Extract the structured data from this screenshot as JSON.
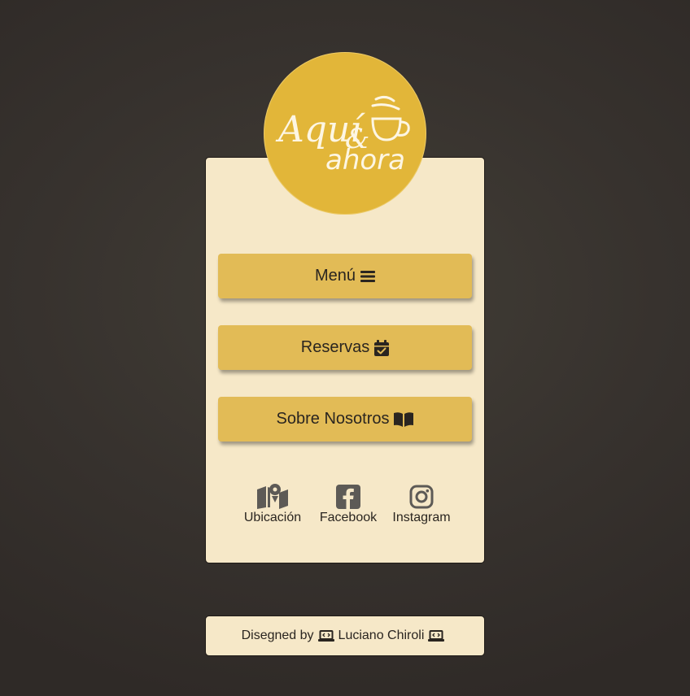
{
  "logo": {
    "line1": "Aquí",
    "amp": "&",
    "line2": "ahora",
    "icon": "coffee-cup-icon"
  },
  "buttons": {
    "menu_label": "Menú",
    "menu_icon": "bars-icon",
    "reservas_label": "Reservas",
    "reservas_icon": "calendar-check-icon",
    "about_label": "Sobre Nosotros",
    "about_icon": "book-open-icon"
  },
  "social": {
    "ubicacion_label": "Ubicación",
    "ubicacion_icon": "map-location-icon",
    "facebook_label": "Facebook",
    "facebook_icon": "facebook-icon",
    "instagram_label": "Instagram",
    "instagram_icon": "instagram-icon"
  },
  "footer": {
    "prefix": "Disegned by",
    "author": "Luciano Chiroli",
    "icon": "laptop-code-icon"
  },
  "colors": {
    "background": "#37322e",
    "card": "#f6e8c8",
    "button": "#e2bb56",
    "logo_circle": "#e2b639",
    "text": "#2a2520",
    "social_icon": "#5d5a56"
  }
}
